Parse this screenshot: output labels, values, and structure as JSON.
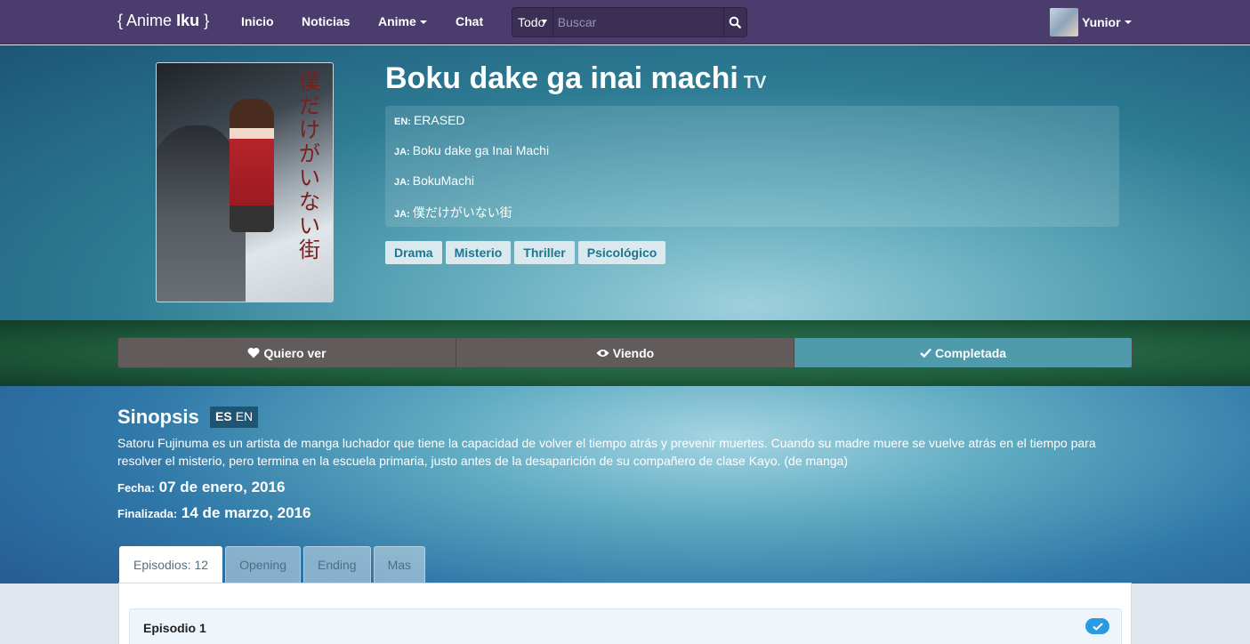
{
  "navbar": {
    "brand_open": "{",
    "brand_text": "Anime",
    "brand_bold": "Iku",
    "brand_close": "}",
    "links": [
      "Inicio",
      "Noticias",
      "Anime",
      "Chat"
    ],
    "search_scope": "Todo",
    "search_placeholder": "Buscar",
    "user_name": "Yunior"
  },
  "anime": {
    "title": "Boku dake ga inai machi",
    "type": "TV",
    "poster_kanji": "僕だけがいない街",
    "alt_titles": [
      {
        "lang": "EN:",
        "value": "ERASED"
      },
      {
        "lang": "JA:",
        "value": "Boku dake ga Inai Machi"
      },
      {
        "lang": "JA:",
        "value": "BokuMachi"
      },
      {
        "lang": "JA:",
        "value": "僕だけがいない街"
      }
    ],
    "genres": [
      "Drama",
      "Misterio",
      "Thriller",
      "Psicológico"
    ]
  },
  "status": {
    "want": "Quiero ver",
    "watching": "Viendo",
    "completed": "Completada",
    "selected": "completed"
  },
  "synopsis": {
    "heading": "Sinopsis",
    "lang_es": "ES",
    "lang_en": "EN",
    "text": "Satoru Fujinuma es un artista de manga luchador que tiene la capacidad de volver el tiempo atrás y prevenir muertes. Cuando su madre muere se vuelve atrás en el tiempo para resolver el misterio, pero termina en la escuela primaria, justo antes de la desaparición de su compañero de clase Kayo. (de manga)",
    "fecha_label": "Fecha:",
    "fecha_value": "07 de enero, 2016",
    "finalizada_label": "Finalizada:",
    "finalizada_value": "14 de marzo, 2016"
  },
  "tabs": [
    "Episodios: 12",
    "Opening",
    "Ending",
    "Mas"
  ],
  "episodes": [
    {
      "label": "Episodio 1",
      "watched": true
    }
  ],
  "colors": {
    "navbar": "#4b3c6e",
    "accent": "#4f9aab",
    "check": "#2a9be3"
  }
}
